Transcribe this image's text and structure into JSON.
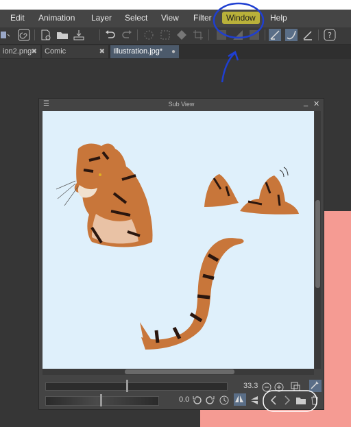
{
  "menu": {
    "items": [
      "Edit",
      "Animation",
      "Layer",
      "Select",
      "View",
      "Filter",
      "Window",
      "Help"
    ],
    "highlighted": "Window",
    "highlight_color": "#b9b13a"
  },
  "tabs": [
    {
      "label": "ion2.png",
      "close": "✖",
      "active": false
    },
    {
      "label": "Comic",
      "close": "✖",
      "active": false
    },
    {
      "label": "Illustration.jpg*",
      "close": "●",
      "active": true
    }
  ],
  "subview": {
    "title": "Sub View",
    "zoom_value": "33.3",
    "rotation_value": "0.0",
    "background_color": "#dff0fb"
  },
  "icons": {
    "toolbar": [
      "pen-tool-icon",
      "spiral-icon",
      "new-canvas-icon",
      "open-folder-icon",
      "save-icon",
      "undo-icon",
      "redo-icon",
      "selection-icon",
      "transform-icon",
      "fill-icon",
      "crop-icon",
      "grid-icon",
      "ruler-icon",
      "stroke-icon",
      "brush-icon",
      "eraser-icon",
      "help-icon"
    ],
    "subview": [
      "zoom-out-icon",
      "zoom-in-icon",
      "fit-icon",
      "eyedropper-icon",
      "rotate-left-icon",
      "rotate-right-icon",
      "reset-rotation-icon",
      "flip-horizontal-icon",
      "flip-vertical-icon",
      "previous-icon",
      "next-icon",
      "import-folder-icon",
      "delete-icon"
    ]
  },
  "annotation_colors": {
    "blue": "#1f3fd1",
    "white": "#ffffff"
  }
}
